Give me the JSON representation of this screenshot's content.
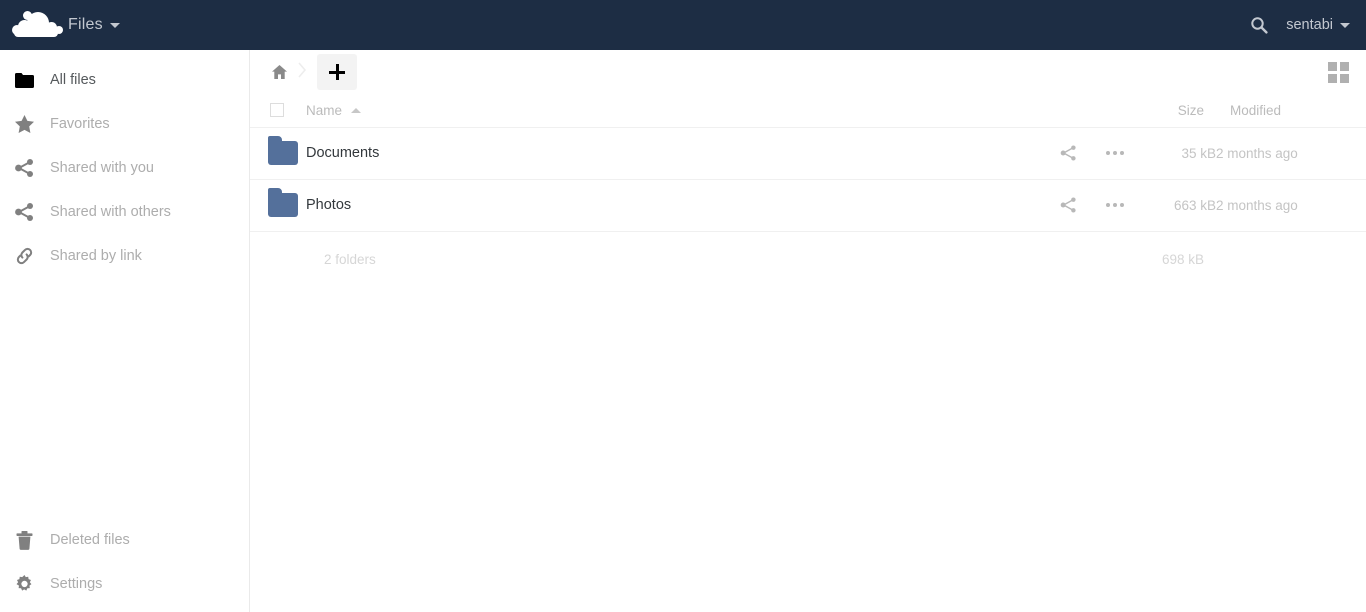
{
  "header": {
    "logo_icon": "owncloud-cloud-logo",
    "app_title": "Files",
    "app_caret_icon": "caret-down-icon",
    "search_icon": "search-icon",
    "username": "sentabi",
    "user_caret_icon": "caret-down-icon",
    "background_color": "#1d2d44"
  },
  "sidebar": {
    "top_items": [
      {
        "label": "All files",
        "icon": "folder-icon",
        "active": true
      },
      {
        "label": "Favorites",
        "icon": "star-icon",
        "active": false
      },
      {
        "label": "Shared with you",
        "icon": "share-icon",
        "active": false
      },
      {
        "label": "Shared with others",
        "icon": "share-icon",
        "active": false
      },
      {
        "label": "Shared by link",
        "icon": "link-icon",
        "active": false
      }
    ],
    "bottom_items": [
      {
        "label": "Deleted files",
        "icon": "trash-icon"
      },
      {
        "label": "Settings",
        "icon": "gear-icon"
      }
    ]
  },
  "toolbar": {
    "home_icon": "home-icon",
    "separator_icon": "chevron-right-icon",
    "new_button_icon": "plus-icon",
    "grid_view_icon": "grid-view-icon"
  },
  "filelist": {
    "columns": {
      "name": "Name",
      "size": "Size",
      "modified": "Modified"
    },
    "sort": {
      "column": "Name",
      "direction_icon": "sort-ascending-icon"
    },
    "select_all_checkbox": "",
    "rows": [
      {
        "icon": "folder-icon",
        "name": "Documents",
        "share_icon": "share-icon",
        "more_icon": "more-actions-icon",
        "size": "35 kB",
        "modified": "2 months ago"
      },
      {
        "icon": "folder-icon",
        "name": "Photos",
        "share_icon": "share-icon",
        "more_icon": "more-actions-icon",
        "size": "663 kB",
        "modified": "2 months ago"
      }
    ],
    "summary": {
      "count_label": "2 folders",
      "total_size": "698 kB"
    }
  },
  "colors": {
    "header_bg": "#1d2d44",
    "folder_blue": "#54709b",
    "muted_text": "#c4c4c4"
  }
}
